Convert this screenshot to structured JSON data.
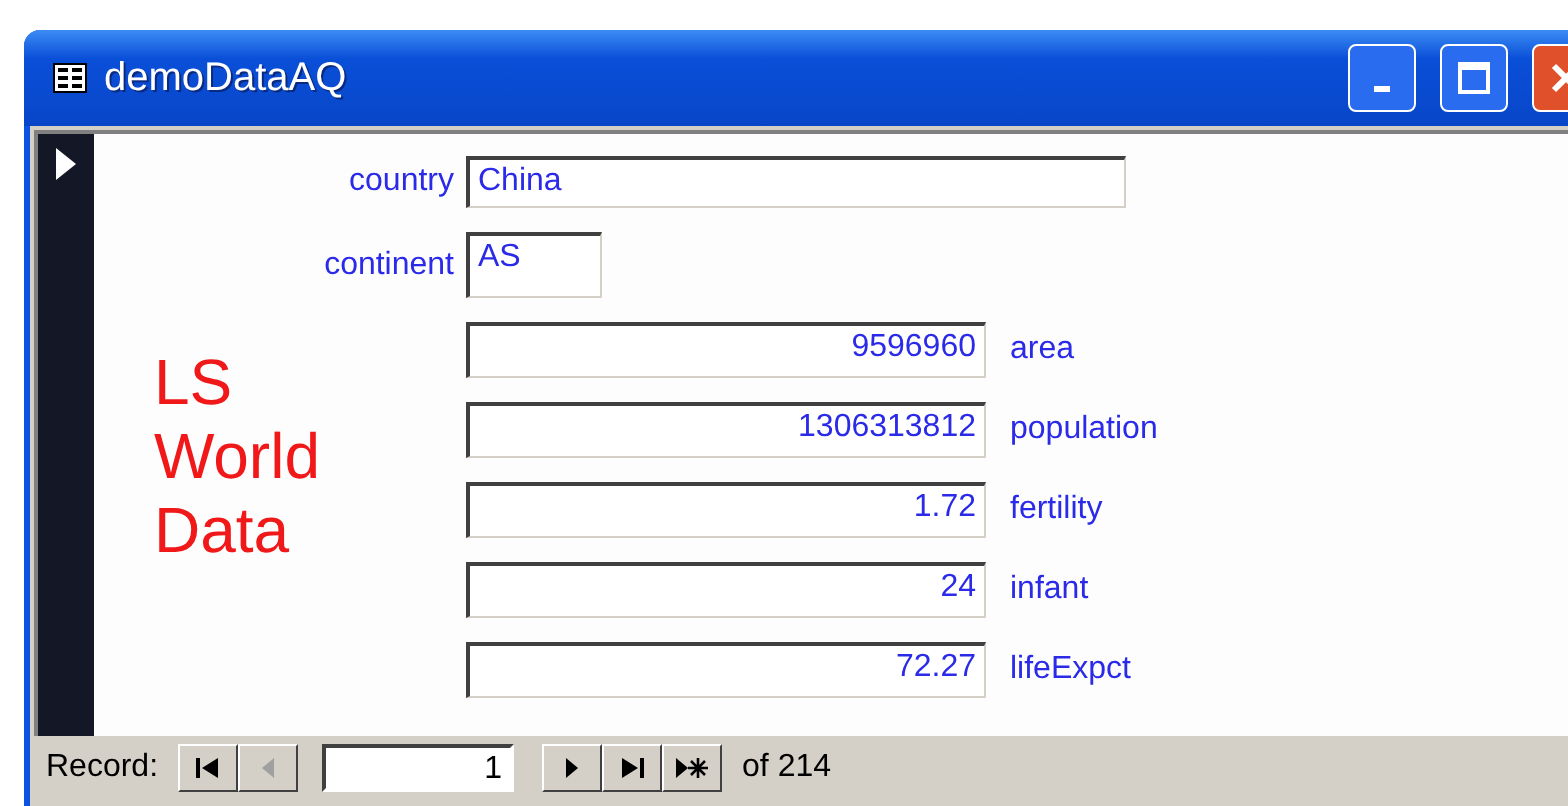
{
  "window": {
    "title": "demoDataAQ"
  },
  "fields": [
    {
      "kind": "text",
      "label": "country",
      "value": "China"
    },
    {
      "kind": "short",
      "label": "continent",
      "value": "AS"
    },
    {
      "kind": "number",
      "label": "area",
      "value": "9596960"
    },
    {
      "kind": "number",
      "label": "population",
      "value": "1306313812"
    },
    {
      "kind": "number",
      "label": "fertility",
      "value": "1.72"
    },
    {
      "kind": "number",
      "label": "infant",
      "value": "24"
    },
    {
      "kind": "number",
      "label": "lifeExpct",
      "value": "72.27"
    }
  ],
  "logo_lines": [
    "LS",
    "World",
    "Data"
  ],
  "navigator": {
    "label": "Record:",
    "current": "1",
    "total": "of 214",
    "buttons": [
      {
        "kind": "first",
        "disabled": false
      },
      {
        "kind": "prev",
        "disabled": true
      },
      {
        "kind": "next",
        "disabled": false
      },
      {
        "kind": "last",
        "disabled": false
      },
      {
        "kind": "new",
        "disabled": false
      }
    ]
  }
}
